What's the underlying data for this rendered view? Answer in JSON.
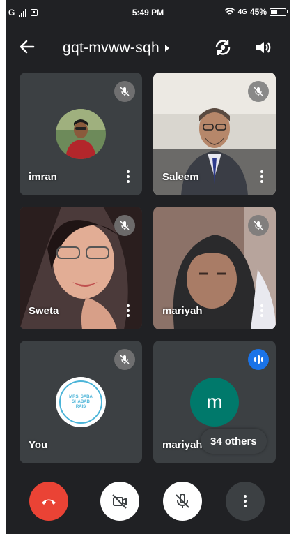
{
  "status_bar": {
    "network": "G",
    "time": "5:49 PM",
    "network_type": "4G",
    "battery": "45%"
  },
  "header": {
    "meeting_code": "gqt-mvww-sqh"
  },
  "participants": [
    {
      "name": "imran",
      "muted": true
    },
    {
      "name": "Saleem",
      "muted": true
    },
    {
      "name": "Sweta",
      "muted": true
    },
    {
      "name": "mariyah",
      "muted": true
    },
    {
      "name": "You",
      "muted": true,
      "avatar_text": "MRS. SABA SHABAB RAIS"
    },
    {
      "name": "mariyah",
      "speaking": true,
      "initial": "m",
      "others_label": "34 others"
    }
  ],
  "controls": {
    "hangup": "end-call-icon",
    "camera": "camera-off-icon",
    "mic": "mic-off-icon",
    "more": "more-vert-icon"
  },
  "colors": {
    "background": "#202124",
    "tile": "#3c4043",
    "hangup": "#ea4335",
    "speaking": "#1a73e8",
    "avatar_teal": "#00796b"
  }
}
